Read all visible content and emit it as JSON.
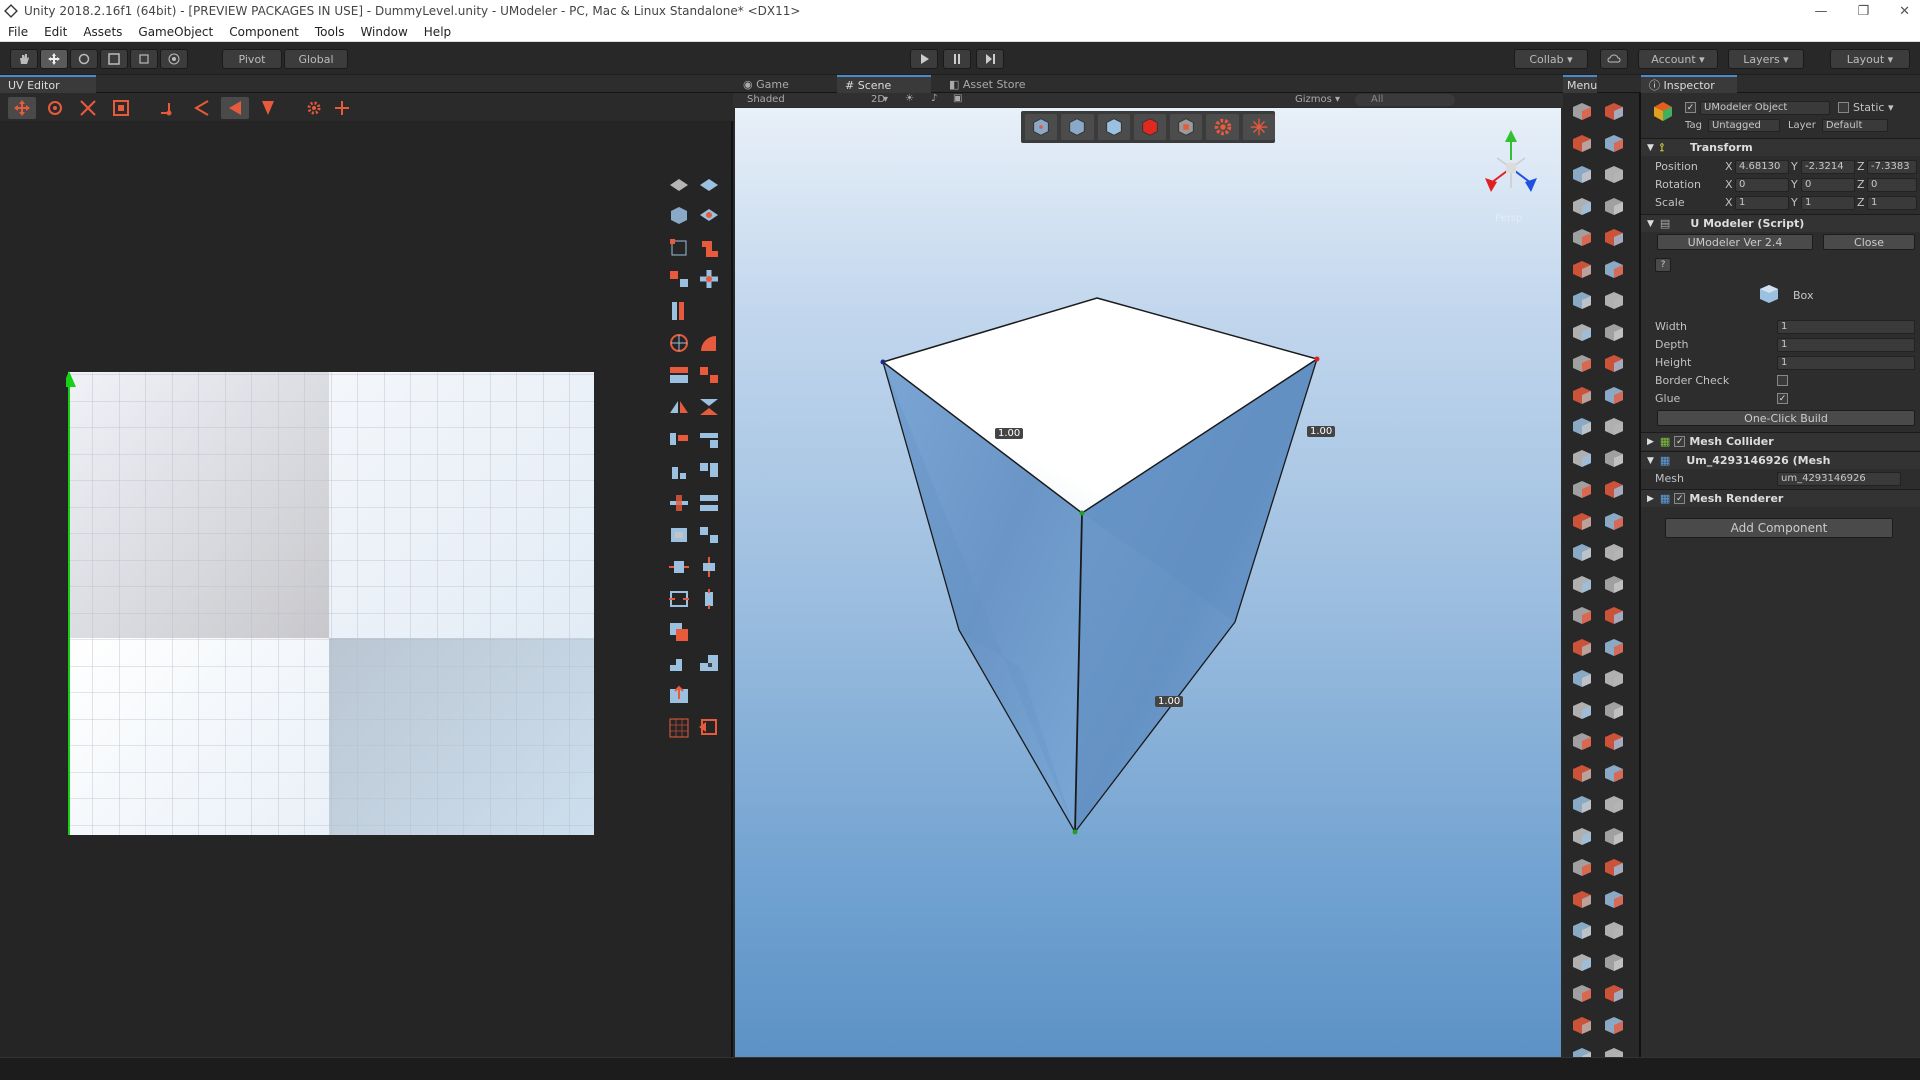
{
  "window": {
    "title": "Unity 2018.2.16f1 (64bit) - [PREVIEW PACKAGES IN USE] - DummyLevel.unity - UModeler - PC, Mac & Linux Standalone* <DX11>",
    "minimize": "—",
    "restore": "❐",
    "close": "✕"
  },
  "menu": [
    "File",
    "Edit",
    "Assets",
    "GameObject",
    "Component",
    "Tools",
    "Window",
    "Help"
  ],
  "toolbar": {
    "pivot": "Pivot",
    "global": "Global",
    "collab": "Collab ▾",
    "account": "Account",
    "layers": "Layers",
    "layout": "Layout"
  },
  "uv_editor": {
    "tab": "UV Editor"
  },
  "scene": {
    "tabs": [
      "Game",
      "Scene",
      "Asset Store"
    ],
    "shading": "Shaded",
    "mode_2d": "2D",
    "gizmos": "Gizmos ▾",
    "search_placeholder": "All",
    "dimensions": [
      "1.00",
      "1.00",
      "1.00"
    ],
    "persp": "Persp"
  },
  "menu_panel": {
    "tab": "Menu"
  },
  "inspector": {
    "tab": "Inspector",
    "object_name": "UModeler Object",
    "static_label": "Static",
    "tag_label": "Tag",
    "tag_value": "Untagged",
    "layer_label": "Layer",
    "layer_value": "Default",
    "transform": {
      "header": "Transform",
      "position_label": "Position",
      "rotation_label": "Rotation",
      "scale_label": "Scale",
      "position": [
        "4.68130",
        "-2.3214",
        "-7.3383"
      ],
      "rotation": [
        "0",
        "0",
        "0"
      ],
      "scale": [
        "1",
        "1",
        "1"
      ],
      "axes": [
        "X",
        "Y",
        "Z"
      ]
    },
    "umodeler": {
      "header": "U Modeler (Script)",
      "version": "UModeler Ver 2.4",
      "close": "Close",
      "help": "?",
      "shape": "Box",
      "width_label": "Width",
      "width": "1",
      "depth_label": "Depth",
      "depth": "1",
      "height_label": "Height",
      "height": "1",
      "border_check_label": "Border Check",
      "glue_label": "Glue",
      "build": "One-Click Build"
    },
    "mesh_collider": "Mesh Collider",
    "mesh_filter": "Um_4293146926 (Mesh",
    "mesh_label": "Mesh",
    "mesh_value": "um_4293146926",
    "mesh_renderer": "Mesh Renderer",
    "add_component": "Add Component"
  },
  "colors": {
    "accent": "#e85a3c",
    "panel": "#282828",
    "sky_top": "#e8f0f8",
    "sky_bottom": "#5d92c6"
  }
}
